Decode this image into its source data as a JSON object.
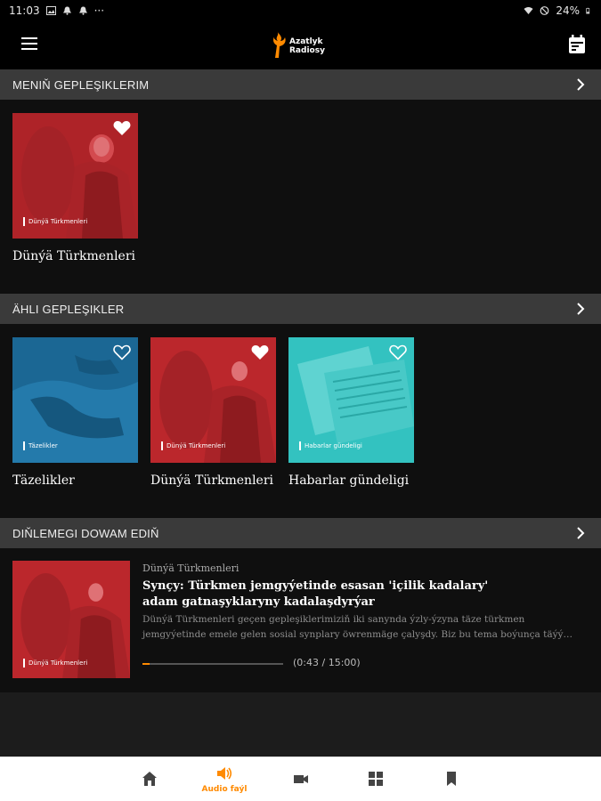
{
  "status_bar": {
    "time": "11:03",
    "battery": "24%",
    "overflow": "···",
    "icons_left": [
      "image-icon",
      "bell-icon",
      "bell-icon"
    ],
    "icons_right": [
      "wifi-icon",
      "do-not-disturb-icon",
      "battery-icon"
    ]
  },
  "app_bar": {
    "logo_line1": "Azatlyk",
    "logo_line2": "Radiosy",
    "menu_icon": "hamburger-icon",
    "calendar_icon": "calendar-icon"
  },
  "sections": {
    "my_podcasts": {
      "title": "MENIŇ GEPLEŞIKLERIM",
      "items": [
        {
          "title": "Dünýä Türkmenleri",
          "tag": "Dünýä Türkmenleri",
          "favorited": true
        }
      ]
    },
    "all_podcasts": {
      "title": "ÄHLI GEPLEŞIKLER",
      "items": [
        {
          "title": "Täzelikler",
          "tag": "Täzelikler",
          "favorited": false
        },
        {
          "title": "Dünýä Türkmenleri",
          "tag": "Dünýä Türkmenleri",
          "favorited": true
        },
        {
          "title": "Habarlar gündeligi",
          "tag": "Habarlar gündeligi",
          "favorited": false
        }
      ]
    },
    "continue_listening": {
      "title": "DIŇLEMEGI DOWAM EDIŇ",
      "episode": {
        "show": "Dünýä Türkmenleri",
        "tag": "Dünýä Türkmenleri",
        "title": "Synçy: Türkmen jemgyýetinde esasan 'içilik kadalary' adam gatnaşyklaryny kadalaşdyrýar",
        "description": "Dünýä Türkmenleri geçen gepleşiklerimiziň iki sanynda ýzly-ýzyna täze türkmen jemgyýetinde emele gelen sosial synplary öwrenmäge çalyşdy. Biz bu tema boýunça täýý…",
        "progress_fraction": 0.048,
        "time": "(0:43 / 15:00)"
      }
    }
  },
  "bottom_nav": {
    "items": [
      {
        "id": "home",
        "icon": "home-icon",
        "label": ""
      },
      {
        "id": "audio",
        "icon": "speaker-icon",
        "label": "Audio faýl",
        "active": true
      },
      {
        "id": "video",
        "icon": "video-camera-icon",
        "label": ""
      },
      {
        "id": "sections",
        "icon": "grid-icon",
        "label": ""
      },
      {
        "id": "bookmarks",
        "icon": "bookmark-icon",
        "label": ""
      }
    ]
  },
  "colors": {
    "accent": "#ff8a00",
    "section_header": "#3a3a3a",
    "background": "#1c1c1c",
    "thumb_red": "#b8262b",
    "thumb_blue": "#1f6f9e",
    "thumb_teal": "#33c2c0"
  }
}
